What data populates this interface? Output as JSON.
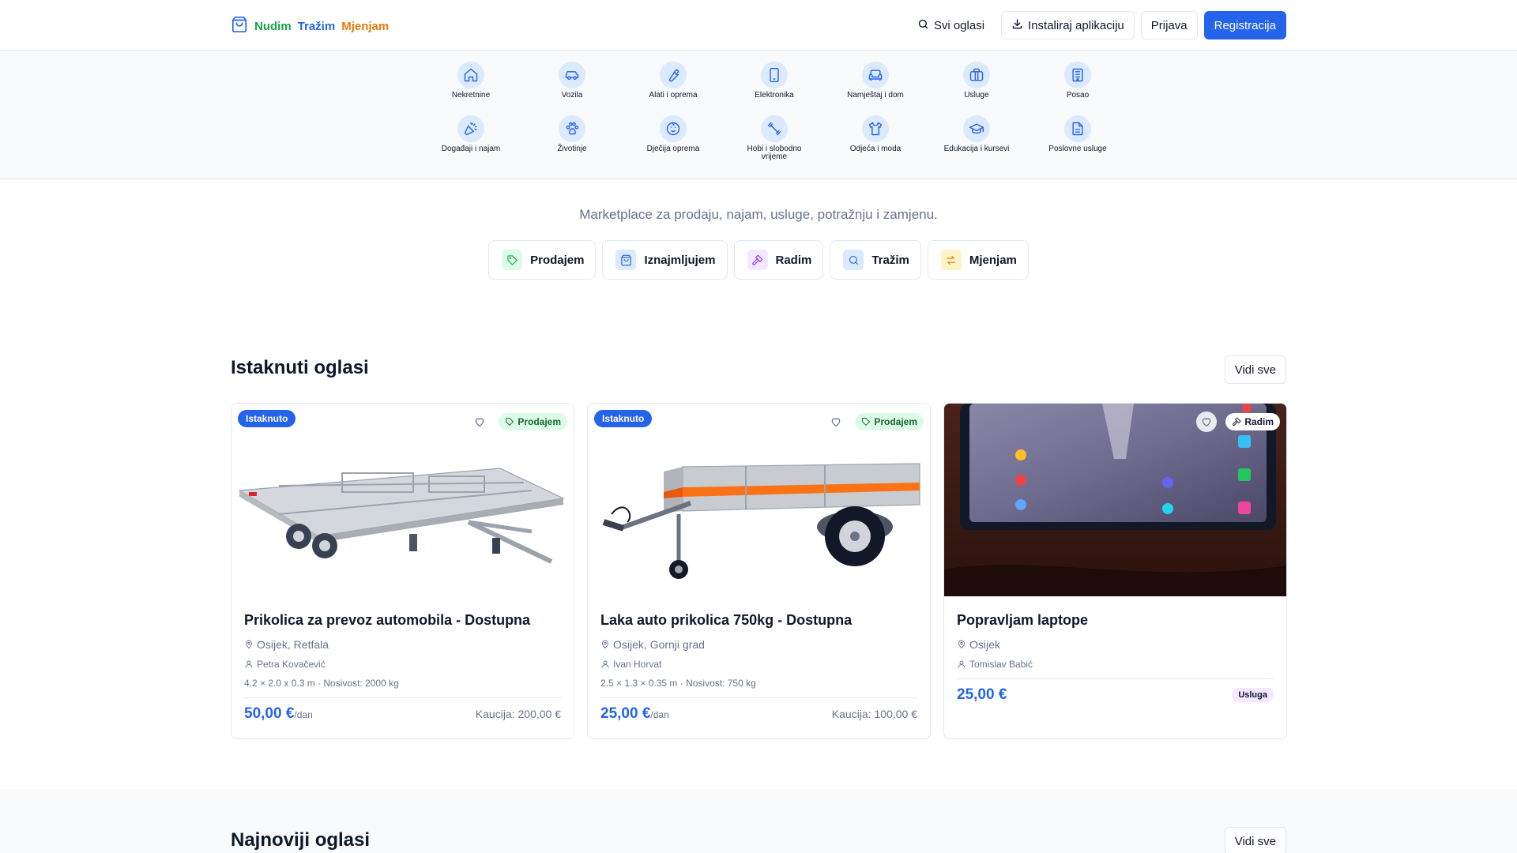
{
  "header": {
    "logo": {
      "word1": "Nudim",
      "word2": "Tražim",
      "word3": "Mjenjam"
    },
    "nav": {
      "all_ads": "Svi oglasi",
      "install": "Instaliraj aplikaciju",
      "login": "Prijava",
      "register": "Registracija"
    }
  },
  "categories": [
    {
      "label": "Nekretnine",
      "icon": "house-icon"
    },
    {
      "label": "Vozila",
      "icon": "car-icon"
    },
    {
      "label": "Alati i oprema",
      "icon": "wrench-icon"
    },
    {
      "label": "Elektronika",
      "icon": "smartphone-icon"
    },
    {
      "label": "Namještaj i dom",
      "icon": "sofa-icon"
    },
    {
      "label": "Usluge",
      "icon": "briefcase-icon"
    },
    {
      "label": "Posao",
      "icon": "building-icon"
    },
    {
      "label": "Događaji i najam",
      "icon": "party-popper-icon"
    },
    {
      "label": "Životinje",
      "icon": "paw-icon"
    },
    {
      "label": "Dječija oprema",
      "icon": "baby-icon"
    },
    {
      "label": "Hobi i slobodno vrijeme",
      "icon": "dumbbell-icon"
    },
    {
      "label": "Odjeća i moda",
      "icon": "shirt-icon"
    },
    {
      "label": "Edukacija i kursevi",
      "icon": "graduation-cap-icon"
    },
    {
      "label": "Poslovne usluge",
      "icon": "document-icon"
    }
  ],
  "hero": {
    "tagline": "Marketplace za prodaju, najam, usluge, potražnju i zamjenu.",
    "types": [
      {
        "label": "Prodajem",
        "icon": "tag-icon",
        "color": "#16a34a",
        "bg": "#dcfce7"
      },
      {
        "label": "Iznajmljujem",
        "icon": "shopping-bag-icon",
        "color": "#2563eb",
        "bg": "#dbeafe"
      },
      {
        "label": "Radim",
        "icon": "hammer-icon",
        "color": "#9333ea",
        "bg": "#f3e8ff"
      },
      {
        "label": "Tražim",
        "icon": "search-icon",
        "color": "#2563eb",
        "bg": "#dbeafe"
      },
      {
        "label": "Mjenjam",
        "icon": "swap-icon",
        "color": "#d97706",
        "bg": "#fef3c7"
      }
    ]
  },
  "featured": {
    "title": "Istaknuti oglasi",
    "view_all": "Vidi sve",
    "cards": [
      {
        "featured_badge": "Istaknuto",
        "type_badge": "Prodajem",
        "title": "Prikolica za prevoz automobila - Dostupna",
        "location": "Osijek, Retfala",
        "user": "Petra Kovačević",
        "spec": "4.2 × 2.0 x 0.3 m · Nosivost: 2000 kg",
        "price": "50,00 €",
        "price_unit": "/dan",
        "deposit": "Kaucija: 200,00 €"
      },
      {
        "featured_badge": "Istaknuto",
        "type_badge": "Prodajem",
        "title": "Laka auto prikolica 750kg - Dostupna",
        "location": "Osijek, Gornji grad",
        "user": "Ivan Horvat",
        "spec": "2.5 × 1.3 × 0.35 m · Nosivost: 750 kg",
        "price": "25,00 €",
        "price_unit": "/dan",
        "deposit": "Kaucija: 100,00 €"
      },
      {
        "type_badge": "Radim",
        "title": "Popravljam laptope",
        "location": "Osijek",
        "user": "Tomislav Babić",
        "price": "25,00 €",
        "service_badge": "Usluga"
      }
    ]
  },
  "newest": {
    "title": "Najnoviji oglasi",
    "view_all": "Vidi sve"
  }
}
